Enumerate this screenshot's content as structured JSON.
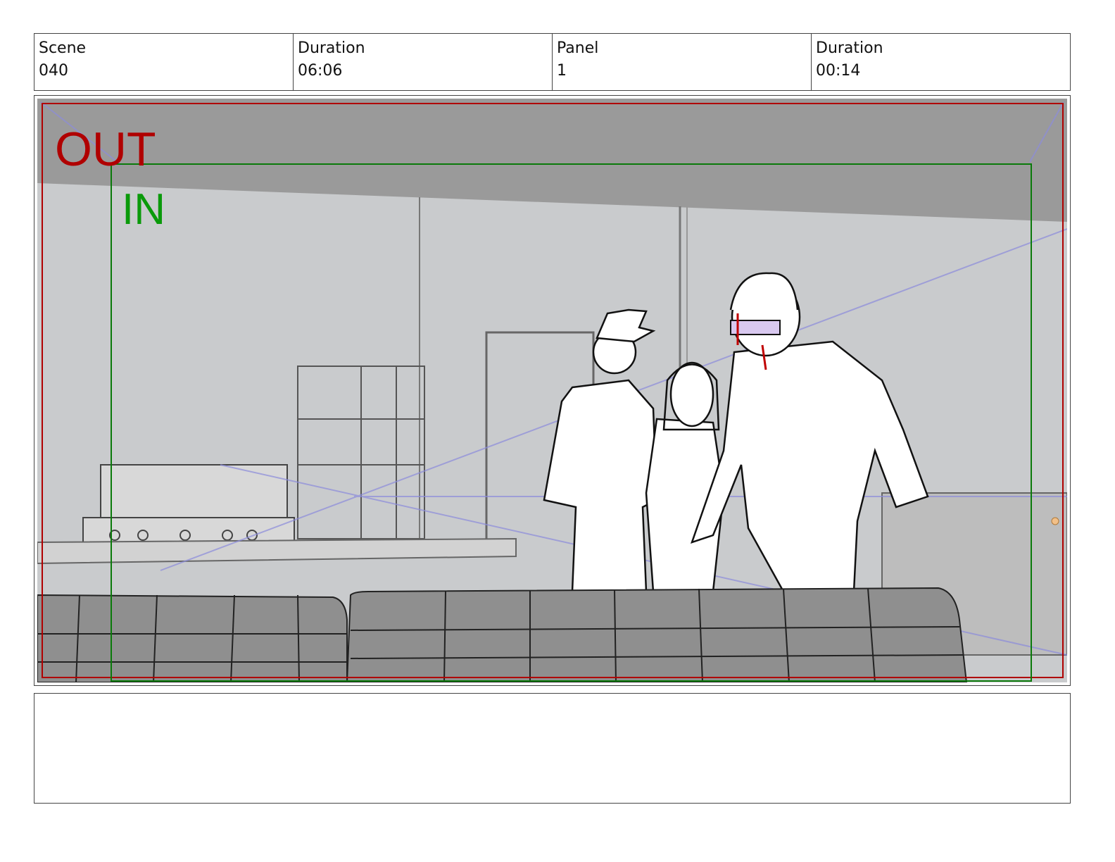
{
  "header": {
    "scene_label": "Scene",
    "scene_value": "040",
    "scene_duration_label": "Duration",
    "scene_duration_value": "06:06",
    "panel_label": "Panel",
    "panel_value": "1",
    "panel_duration_label": "Duration",
    "panel_duration_value": "00:14"
  },
  "frame": {
    "out_label": "OUT",
    "in_label": "IN",
    "out_color": "#b00000",
    "in_color": "#0a9a0a"
  },
  "notes": {
    "text": ""
  }
}
